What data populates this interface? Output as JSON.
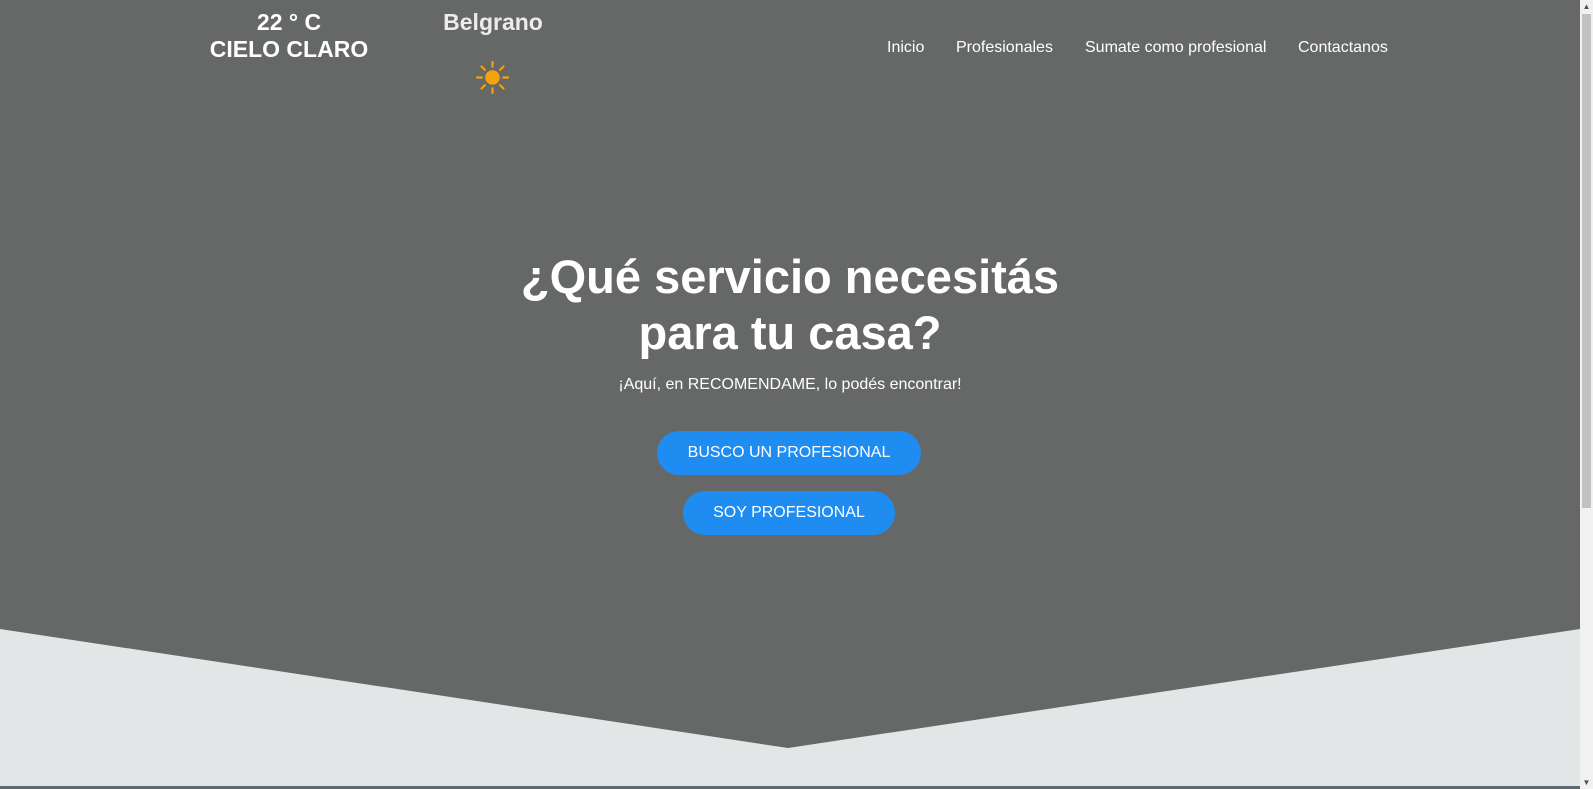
{
  "weather": {
    "temperature": "22 ° C",
    "condition": "CIELO CLARO",
    "city": "Belgrano",
    "icon": "sun-icon"
  },
  "nav": {
    "items": [
      {
        "label": "Inicio"
      },
      {
        "label": "Profesionales"
      },
      {
        "label": "Sumate como profesional"
      },
      {
        "label": "Contactanos"
      }
    ]
  },
  "hero": {
    "title_line1": "¿Qué servicio necesitás",
    "title_line2": "para tu casa?",
    "subtitle": "¡Aquí, en RECOMENDAME, lo podés encontrar!",
    "primary_button": "BUSCO UN PROFESIONAL",
    "secondary_button": "SOY PROFESIONAL"
  },
  "colors": {
    "hero_background": "#666867",
    "page_background": "#e2e6e7",
    "button": "#1e8cf0",
    "sun": "#f5a20c"
  },
  "scrollbar": {
    "up_arrow": "▲",
    "down_arrow": "▼"
  }
}
